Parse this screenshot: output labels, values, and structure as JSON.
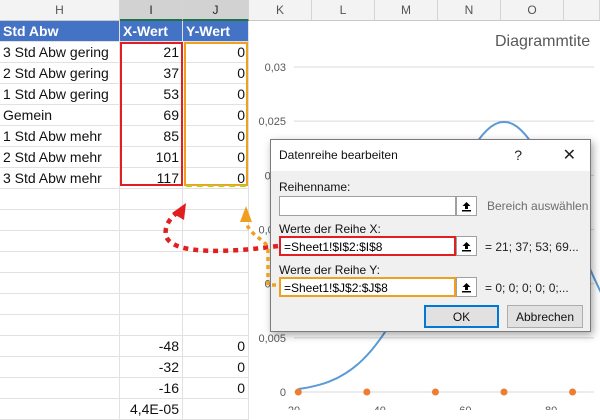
{
  "columns": [
    "H",
    "I",
    "J",
    "K",
    "L",
    "M",
    "N",
    "O"
  ],
  "table": {
    "headers": [
      "Std Abw",
      "X-Wert",
      "Y-Wert"
    ],
    "rows": [
      [
        "3 Std Abw gering",
        "21",
        "0"
      ],
      [
        "2 Std Abw gering",
        "37",
        "0"
      ],
      [
        "1 Std Abw gering",
        "53",
        "0"
      ],
      [
        "Gemein",
        "69",
        "0"
      ],
      [
        "1 Std Abw mehr",
        "85",
        "0"
      ],
      [
        "2 Std Abw mehr",
        "101",
        "0"
      ],
      [
        "3 Std Abw mehr",
        "117",
        "0"
      ]
    ],
    "lower_rows": [
      [
        "-48",
        "0"
      ],
      [
        "-32",
        "0"
      ],
      [
        "-16",
        "0"
      ],
      [
        "4,4E-05",
        ""
      ]
    ]
  },
  "chart_data": {
    "type": "scatter",
    "title": "Diagrammtite",
    "yticks": [
      "0,03",
      "0,025",
      "0,02",
      "0,015",
      "0,01",
      "0,005",
      "0"
    ],
    "xticks": [
      "20",
      "40",
      "60",
      "80"
    ],
    "ylim": [
      0,
      0.03
    ],
    "xlim": [
      20,
      90
    ],
    "series": [
      {
        "x": [
          21,
          37,
          53,
          69,
          85
        ],
        "y": [
          0,
          0,
          0,
          0,
          0
        ],
        "color": "#ed7d31"
      }
    ],
    "curve_color": "#5b9bd5"
  },
  "dialog": {
    "title": "Datenreihe bearbeiten",
    "help": "?",
    "close": "✕",
    "name_label": "Reihenname:",
    "name_value": "",
    "range_hint": "Bereich auswählen",
    "x_label": "Werte der Reihe X:",
    "x_value": "=Sheet1!$I$2:$I$8",
    "x_preview": "= 21; 37; 53; 69...",
    "y_label": "Werte der Reihe Y:",
    "y_value": "=Sheet1!$J$2:$J$8",
    "y_preview": "= 0; 0; 0; 0; 0;...",
    "ok": "OK",
    "cancel": "Abbrechen"
  },
  "colors": {
    "red_highlight": "#e02020",
    "orange_highlight": "#f0a020",
    "header_fill": "#4472c4"
  }
}
